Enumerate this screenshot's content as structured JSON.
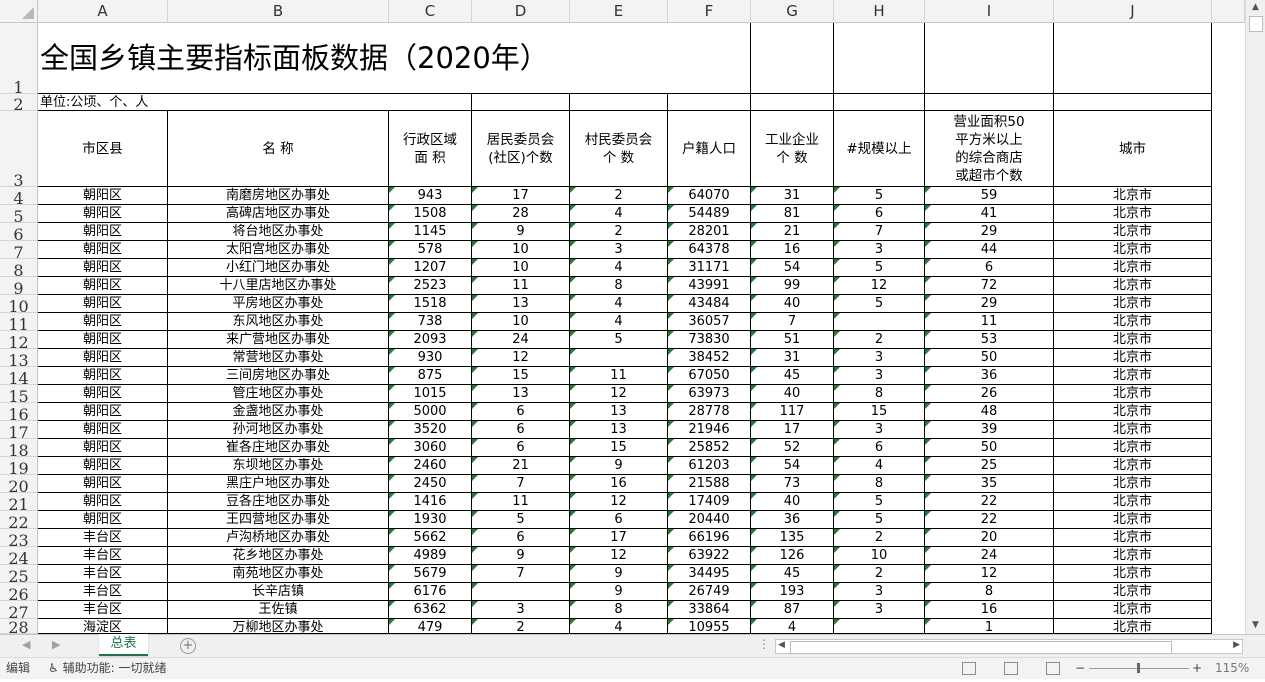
{
  "columns": [
    "A",
    "B",
    "C",
    "D",
    "E",
    "F",
    "G",
    "H",
    "I",
    "J"
  ],
  "rows": [
    "1",
    "2",
    "3",
    "4",
    "5",
    "6",
    "7",
    "8",
    "9",
    "10",
    "11",
    "12",
    "13",
    "14",
    "15",
    "16",
    "17",
    "18",
    "19",
    "20",
    "21",
    "22",
    "23",
    "24",
    "25",
    "26",
    "27",
    "28"
  ],
  "title": "全国乡镇主要指标面板数据（2020年）",
  "unit_label": "单位:公顷、个、人",
  "headers": [
    "市区县",
    "名 称",
    "行政区域\n面 积",
    "居民委员会\n(社区)个数",
    "村民委员会\n个 数",
    "户籍人口",
    "工业企业\n个 数",
    "#规模以上",
    "营业面积50\n平方米以上\n的综合商店\n或超市个数",
    "城市"
  ],
  "data_rows": [
    [
      "朝阳区",
      "南磨房地区办事处",
      "943",
      "17",
      "2",
      "64070",
      "31",
      "5",
      "59",
      "北京市"
    ],
    [
      "朝阳区",
      "高碑店地区办事处",
      "1508",
      "28",
      "4",
      "54489",
      "81",
      "6",
      "41",
      "北京市"
    ],
    [
      "朝阳区",
      "将台地区办事处",
      "1145",
      "9",
      "2",
      "28201",
      "21",
      "7",
      "29",
      "北京市"
    ],
    [
      "朝阳区",
      "太阳宫地区办事处",
      "578",
      "10",
      "3",
      "64378",
      "16",
      "3",
      "44",
      "北京市"
    ],
    [
      "朝阳区",
      "小红门地区办事处",
      "1207",
      "10",
      "4",
      "31171",
      "54",
      "5",
      "6",
      "北京市"
    ],
    [
      "朝阳区",
      "十八里店地区办事处",
      "2523",
      "11",
      "8",
      "43991",
      "99",
      "12",
      "72",
      "北京市"
    ],
    [
      "朝阳区",
      "平房地区办事处",
      "1518",
      "13",
      "4",
      "43484",
      "40",
      "5",
      "29",
      "北京市"
    ],
    [
      "朝阳区",
      "东风地区办事处",
      "738",
      "10",
      "4",
      "36057",
      "7",
      "",
      "11",
      "北京市"
    ],
    [
      "朝阳区",
      "来广营地区办事处",
      "2093",
      "24",
      "5",
      "73830",
      "51",
      "2",
      "53",
      "北京市"
    ],
    [
      "朝阳区",
      "常营地区办事处",
      "930",
      "12",
      "",
      "38452",
      "31",
      "3",
      "50",
      "北京市"
    ],
    [
      "朝阳区",
      "三间房地区办事处",
      "875",
      "15",
      "11",
      "67050",
      "45",
      "3",
      "36",
      "北京市"
    ],
    [
      "朝阳区",
      "管庄地区办事处",
      "1015",
      "13",
      "12",
      "63973",
      "40",
      "8",
      "26",
      "北京市"
    ],
    [
      "朝阳区",
      "金盏地区办事处",
      "5000",
      "6",
      "13",
      "28778",
      "117",
      "15",
      "48",
      "北京市"
    ],
    [
      "朝阳区",
      "孙河地区办事处",
      "3520",
      "6",
      "13",
      "21946",
      "17",
      "3",
      "39",
      "北京市"
    ],
    [
      "朝阳区",
      "崔各庄地区办事处",
      "3060",
      "6",
      "15",
      "25852",
      "52",
      "6",
      "50",
      "北京市"
    ],
    [
      "朝阳区",
      "东坝地区办事处",
      "2460",
      "21",
      "9",
      "61203",
      "54",
      "4",
      "25",
      "北京市"
    ],
    [
      "朝阳区",
      "黑庄户地区办事处",
      "2450",
      "7",
      "16",
      "21588",
      "73",
      "8",
      "35",
      "北京市"
    ],
    [
      "朝阳区",
      "豆各庄地区办事处",
      "1416",
      "11",
      "12",
      "17409",
      "40",
      "5",
      "22",
      "北京市"
    ],
    [
      "朝阳区",
      "王四营地区办事处",
      "1930",
      "5",
      "6",
      "20440",
      "36",
      "5",
      "22",
      "北京市"
    ],
    [
      "丰台区",
      "卢沟桥地区办事处",
      "5662",
      "6",
      "17",
      "66196",
      "135",
      "2",
      "20",
      "北京市"
    ],
    [
      "丰台区",
      "花乡地区办事处",
      "4989",
      "9",
      "12",
      "63922",
      "126",
      "10",
      "24",
      "北京市"
    ],
    [
      "丰台区",
      "南苑地区办事处",
      "5679",
      "7",
      "9",
      "34495",
      "45",
      "2",
      "12",
      "北京市"
    ],
    [
      "丰台区",
      "长辛店镇",
      "6176",
      "",
      "9",
      "26749",
      "193",
      "3",
      "8",
      "北京市"
    ],
    [
      "丰台区",
      "王佐镇",
      "6362",
      "3",
      "8",
      "33864",
      "87",
      "3",
      "16",
      "北京市"
    ],
    [
      "海淀区",
      "万柳地区办事处",
      "479",
      "2",
      "4",
      "10955",
      "4",
      "",
      "1",
      "北京市"
    ]
  ],
  "sheet_tab": "总表",
  "status": {
    "mode": "编辑",
    "accessibility": "辅助功能: 一切就绪",
    "zoom": "115%"
  },
  "icons": {
    "add_sheet": "plus-circle-icon",
    "accessibility": "accessibility-icon"
  }
}
